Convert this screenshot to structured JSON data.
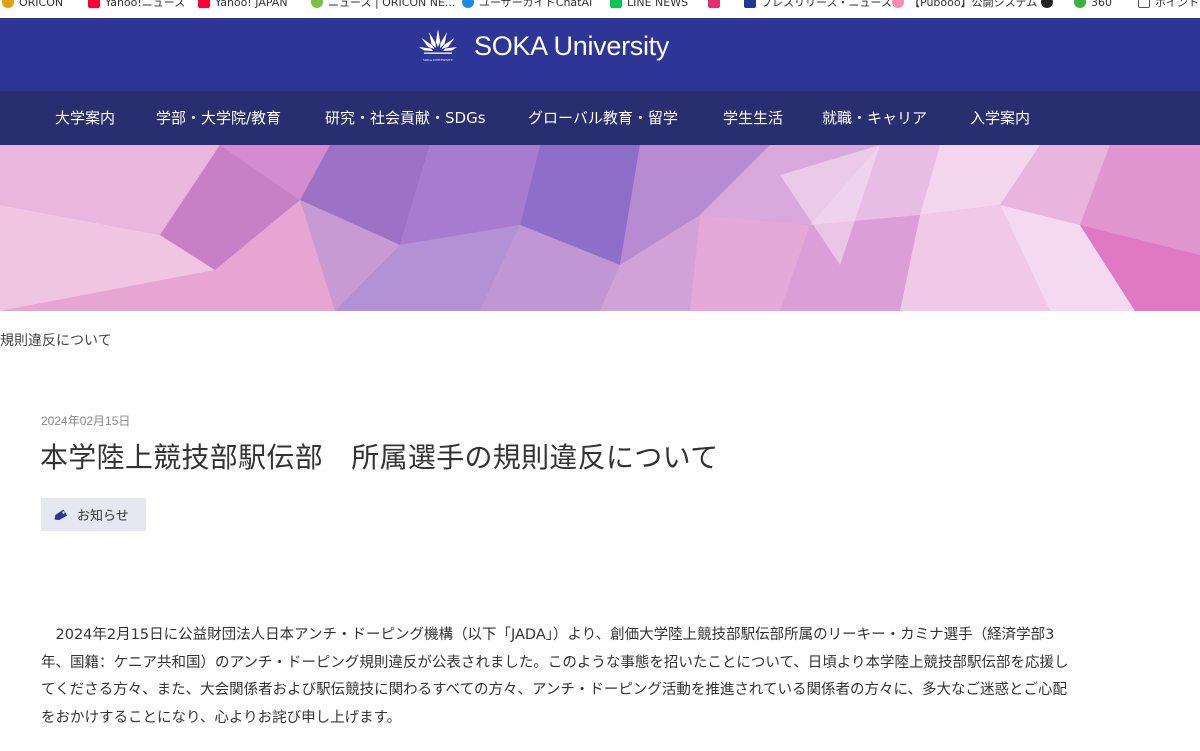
{
  "bookmarks": [
    {
      "label": "ORICON",
      "icon": "oricon-icon",
      "color": "#e0a010"
    },
    {
      "label": "Yahoo!ニュース",
      "icon": "yahoo-icon",
      "color": "#ff0033"
    },
    {
      "label": "Yahoo! JAPAN",
      "icon": "yahoo-icon",
      "color": "#ff0033"
    },
    {
      "label": "ニュース | ORICON NE...",
      "icon": "oricon-icon",
      "color": "#7ac143"
    },
    {
      "label": "ユーザーガイドChatAI",
      "icon": "chat-icon",
      "color": "#1e88e5"
    },
    {
      "label": "LINE NEWS",
      "icon": "line-icon",
      "color": "#06c755"
    },
    {
      "label": "",
      "icon": "instagram-icon",
      "color": "#e1306c"
    },
    {
      "label": "プレスリリース・ニュース...",
      "icon": "pr-icon",
      "color": "#1f3a93"
    },
    {
      "label": "【Pubooo】公開システム",
      "icon": "pig-icon",
      "color": "#f48fb1"
    },
    {
      "label": "",
      "icon": "circle-icon",
      "color": "#222222"
    },
    {
      "label": "360",
      "icon": "360-icon",
      "color": "#3cb043"
    },
    {
      "label": "ポイント",
      "icon": "page-icon",
      "color": "#555555"
    }
  ],
  "header": {
    "logo_text": "SOKA University",
    "logo_small": "SOKA UNIVERSITY",
    "bg_color": "#2d3697"
  },
  "nav": {
    "bg_color": "#282e6f",
    "items": [
      {
        "label": "大学案内"
      },
      {
        "label": "学部・大学院/教育"
      },
      {
        "label": "研究・社会貢献・SDGs"
      },
      {
        "label": "グローバル教育・留学"
      },
      {
        "label": "学生生活"
      },
      {
        "label": "就職・キャリア"
      },
      {
        "label": "入学案内"
      }
    ]
  },
  "breadcrumb": "規則違反について",
  "article": {
    "date": "2024年02月15日",
    "title": "本学陸上競技部駅伝部　所属選手の規則違反について",
    "category": "お知らせ",
    "body": "2024年2月15日に公益財団法人日本アンチ・ドーピング機構（以下「JADA」）より、創価大学陸上競技部駅伝部所属のリーキー・カミナ選手（経済学部3年、国籍：ケニア共和国）のアンチ・ドーピング規則違反が公表されました。このような事態を招いたことについて、日頃より本学陸上競技部駅伝部を応援してくださる方々、また、大会関係者および駅伝競技に関わるすべての方々、アンチ・ドーピング活動を推進されている関係者の方々に、多大なご迷惑とご心配をおかけすることになり、心よりお詫び申し上げます。"
  }
}
